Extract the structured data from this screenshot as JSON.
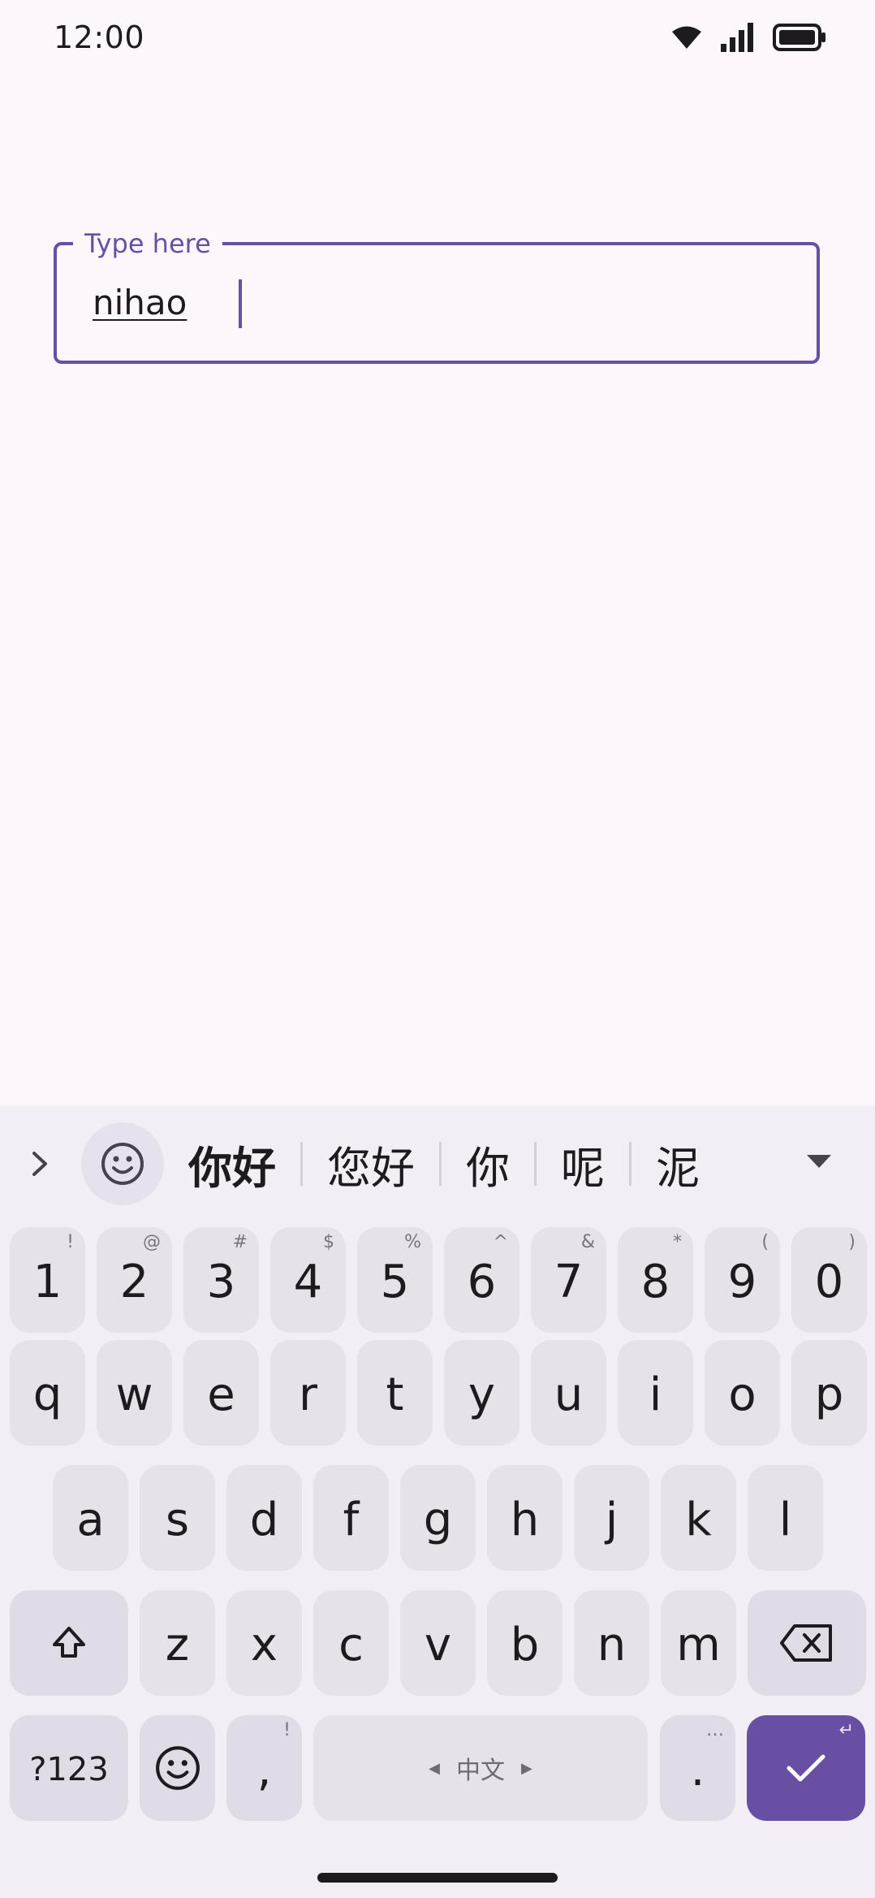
{
  "status": {
    "time": "12:00"
  },
  "field": {
    "label": "Type here",
    "value": "nihao"
  },
  "suggestions": {
    "candidates": [
      "你好",
      "您好",
      "你",
      "呢",
      "泥"
    ]
  },
  "keyboard": {
    "number_row": [
      {
        "k": "1",
        "h": "!"
      },
      {
        "k": "2",
        "h": "@"
      },
      {
        "k": "3",
        "h": "#"
      },
      {
        "k": "4",
        "h": "$"
      },
      {
        "k": "5",
        "h": "%"
      },
      {
        "k": "6",
        "h": "^"
      },
      {
        "k": "7",
        "h": "&"
      },
      {
        "k": "8",
        "h": "*"
      },
      {
        "k": "9",
        "h": "("
      },
      {
        "k": "0",
        "h": ")"
      }
    ],
    "row1": [
      "q",
      "w",
      "e",
      "r",
      "t",
      "y",
      "u",
      "i",
      "o",
      "p"
    ],
    "row2": [
      "a",
      "s",
      "d",
      "f",
      "g",
      "h",
      "j",
      "k",
      "l"
    ],
    "row3": [
      "z",
      "x",
      "c",
      "v",
      "b",
      "n",
      "m"
    ],
    "symbols_label": "?123",
    "comma": {
      "k": ",",
      "h": "!"
    },
    "space_label": "中文",
    "period": {
      "k": ".",
      "h": "…"
    }
  },
  "colors": {
    "accent": "#6750a4",
    "background": "#fdf7fc",
    "keyboard_bg": "#f3eef6",
    "key_bg": "#e7e1ea"
  }
}
